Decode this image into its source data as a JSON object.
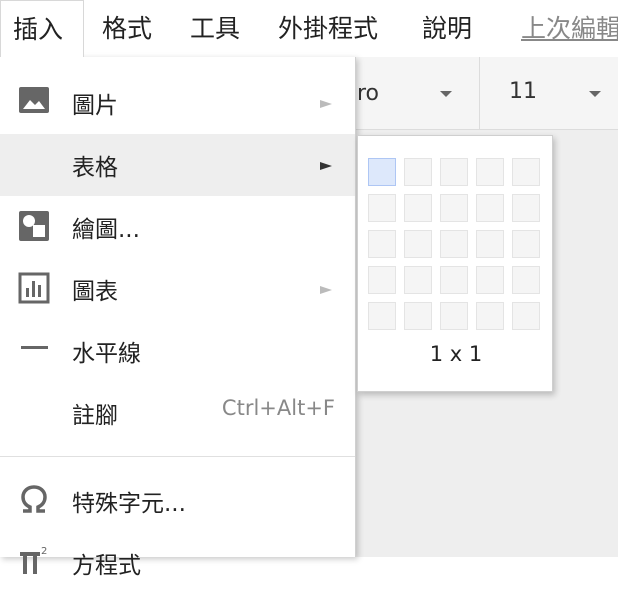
{
  "menubar": {
    "items": [
      {
        "label": "插入"
      },
      {
        "label": "格式"
      },
      {
        "label": "工具"
      },
      {
        "label": "外掛程式"
      },
      {
        "label": "說明"
      }
    ],
    "last_edit": "上次編輯"
  },
  "toolbar": {
    "font_fragment": "ro",
    "font_size": "11"
  },
  "insert_menu": {
    "items": [
      {
        "label": "圖片",
        "icon": "image-icon",
        "has_submenu": true
      },
      {
        "label": "表格",
        "icon": "",
        "has_submenu": true
      },
      {
        "label": "繪圖...",
        "icon": "drawing-icon",
        "has_submenu": false
      },
      {
        "label": "圖表",
        "icon": "chart-icon",
        "has_submenu": true
      },
      {
        "label": "水平線",
        "icon": "horizontal-line-icon",
        "has_submenu": false
      },
      {
        "label": "註腳",
        "icon": "",
        "shortcut": "Ctrl+Alt+F",
        "has_submenu": false
      },
      {
        "label": "特殊字元...",
        "icon": "omega-icon",
        "has_submenu": false
      },
      {
        "label": "方程式",
        "icon": "equation-icon",
        "has_submenu": false
      }
    ]
  },
  "table_picker": {
    "rows": 5,
    "cols": 5,
    "selected_rows": 1,
    "selected_cols": 1,
    "label": "1 x 1"
  },
  "colors": {
    "highlight": "#eeeeee",
    "cell_selected": "#dde8fb",
    "icon": "#666666"
  }
}
